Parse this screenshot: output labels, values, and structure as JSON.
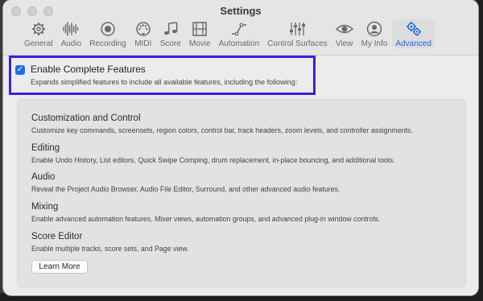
{
  "window": {
    "title": "Settings"
  },
  "toolbar": {
    "items": [
      {
        "label": "General",
        "icon": "gear-icon"
      },
      {
        "label": "Audio",
        "icon": "waveform-icon"
      },
      {
        "label": "Recording",
        "icon": "record-icon"
      },
      {
        "label": "MIDI",
        "icon": "midi-connector-icon"
      },
      {
        "label": "Score",
        "icon": "music-notes-icon"
      },
      {
        "label": "Movie",
        "icon": "film-icon"
      },
      {
        "label": "Automation",
        "icon": "automation-curve-icon"
      },
      {
        "label": "Control Surfaces",
        "icon": "faders-icon"
      },
      {
        "label": "View",
        "icon": "eye-icon"
      },
      {
        "label": "My Info",
        "icon": "person-icon"
      },
      {
        "label": "Advanced",
        "icon": "gears-icon",
        "active": true
      }
    ],
    "accent": "#1b6ae3"
  },
  "advanced": {
    "enable_label": "Enable Complete Features",
    "enable_checked": true,
    "enable_description": "Expands simplified features to include all available features, including the following:",
    "highlight_color": "#3d1ee0",
    "sections": [
      {
        "title": "Customization and Control",
        "description": "Customize key commands, screensets, region colors, control bar, track headers, zoom levels, and controller assignments."
      },
      {
        "title": "Editing",
        "description": "Enable Undo History, List editors, Quick Swipe Comping, drum replacement, in-place bouncing, and additional tools."
      },
      {
        "title": "Audio",
        "description": "Reveal the Project Audio Browser, Audio File Editor, Surround, and other advanced audio features."
      },
      {
        "title": "Mixing",
        "description": "Enable advanced automation features, Mixer views, automation groups, and advanced plug-in window controls."
      },
      {
        "title": "Score Editor",
        "description": "Enable multiple tracks, score sets, and Page view."
      }
    ],
    "learn_more_label": "Learn More"
  }
}
